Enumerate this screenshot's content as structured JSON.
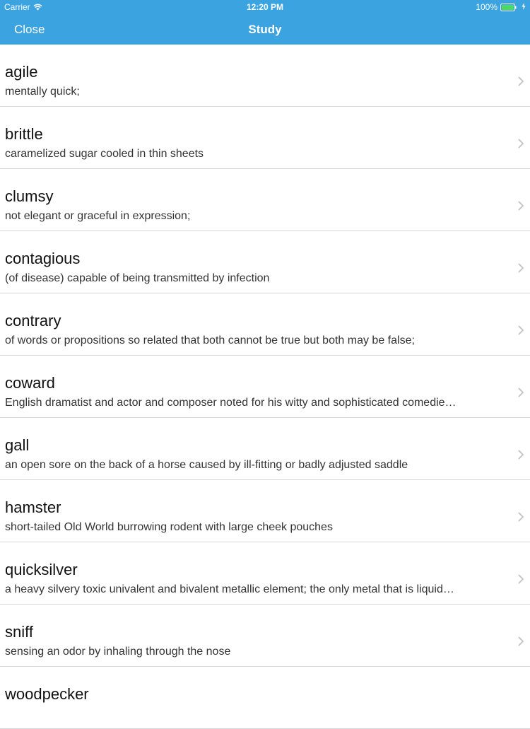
{
  "status": {
    "carrier": "Carrier",
    "time": "12:20 PM",
    "battery": "100%"
  },
  "nav": {
    "close_label": "Close",
    "title": "Study"
  },
  "items": [
    {
      "word": "agile",
      "definition": "mentally quick;"
    },
    {
      "word": "brittle",
      "definition": "caramelized sugar cooled in thin sheets"
    },
    {
      "word": "clumsy",
      "definition": "not elegant or graceful in expression;"
    },
    {
      "word": "contagious",
      "definition": "(of disease) capable of being transmitted by infection"
    },
    {
      "word": "contrary",
      "definition": "of words or propositions so related that both cannot be true but both may be false;"
    },
    {
      "word": "coward",
      "definition": "English dramatist and actor and composer noted for his witty and sophisticated comedie…"
    },
    {
      "word": "gall",
      "definition": "an open sore on the back of a horse caused by ill-fitting or badly adjusted saddle"
    },
    {
      "word": "hamster",
      "definition": "short-tailed Old World burrowing rodent with large cheek pouches"
    },
    {
      "word": "quicksilver",
      "definition": "a heavy silvery toxic univalent and bivalent metallic element; the only metal that is liquid…"
    },
    {
      "word": "sniff",
      "definition": "sensing an odor by inhaling through the nose"
    },
    {
      "word": "woodpecker",
      "definition": ""
    }
  ],
  "colors": {
    "nav_background": "#3aa3e0",
    "separator": "#d6d6d9",
    "chevron": "#c7c7cc",
    "battery_fill": "#4cd964"
  },
  "icons": {
    "wifi": "wifi-icon",
    "battery": "battery-icon",
    "charging": "charging-bolt-icon",
    "row_disclosure": "chevron-right-icon"
  }
}
